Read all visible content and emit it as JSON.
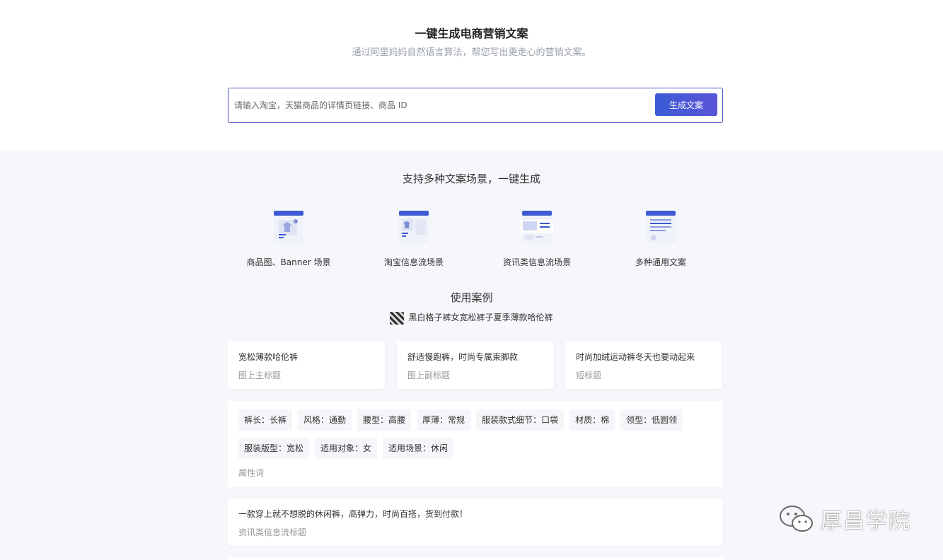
{
  "hero": {
    "title": "一键生成电商营销文案",
    "subtitle": "通过阿里妈妈自然语言算法，帮您写出更走心的营销文案。"
  },
  "search": {
    "placeholder": "请输入淘宝，天猫商品的详情页链接、商品 ID",
    "value": "",
    "button_label": "生成文案"
  },
  "scenes_section": {
    "title": "支持多种文案场景，一键生成",
    "items": [
      {
        "label": "商品图、Banner 场景",
        "icon": "product-image-icon"
      },
      {
        "label": "淘宝信息流场景",
        "icon": "taobao-feed-icon"
      },
      {
        "label": "资讯类信息流场景",
        "icon": "news-feed-icon"
      },
      {
        "label": "多种通用文案",
        "icon": "general-copy-icon"
      }
    ]
  },
  "cases_section": {
    "title": "使用案例",
    "product_name": "黑白格子裤女宽松裤子夏季薄款哈伦裤",
    "titles": [
      {
        "text": "宽松薄款哈伦裤",
        "label": "图上主标题"
      },
      {
        "text": "舒适慢跑裤，时尚专属束脚款",
        "label": "图上副标题"
      },
      {
        "text": "时尚加绒运动裤冬天也要动起来",
        "label": "短标题"
      }
    ],
    "attributes_row1": [
      "裤长：长裤",
      "风格：通勤",
      "腰型：高腰",
      "厚薄：常规",
      "服装款式细节：口袋",
      "材质：棉",
      "领型：低圆领"
    ],
    "attributes_row2": [
      "服装版型：宽松",
      "适用对象：女",
      "适用场景：休闲"
    ],
    "attributes_label": "属性词",
    "feed_title": {
      "text": "一款穿上就不想脱的休闲裤，高弹力，时尚百搭，货到付款！",
      "label": "资讯类信息流标题"
    }
  },
  "watermark": {
    "text": "厚昌学院",
    "icon": "wechat-icon"
  },
  "colors": {
    "accent": "#4a56c9",
    "button": "#3b5bd6",
    "bg_lower": "#f6f7fb",
    "muted": "#999999"
  }
}
